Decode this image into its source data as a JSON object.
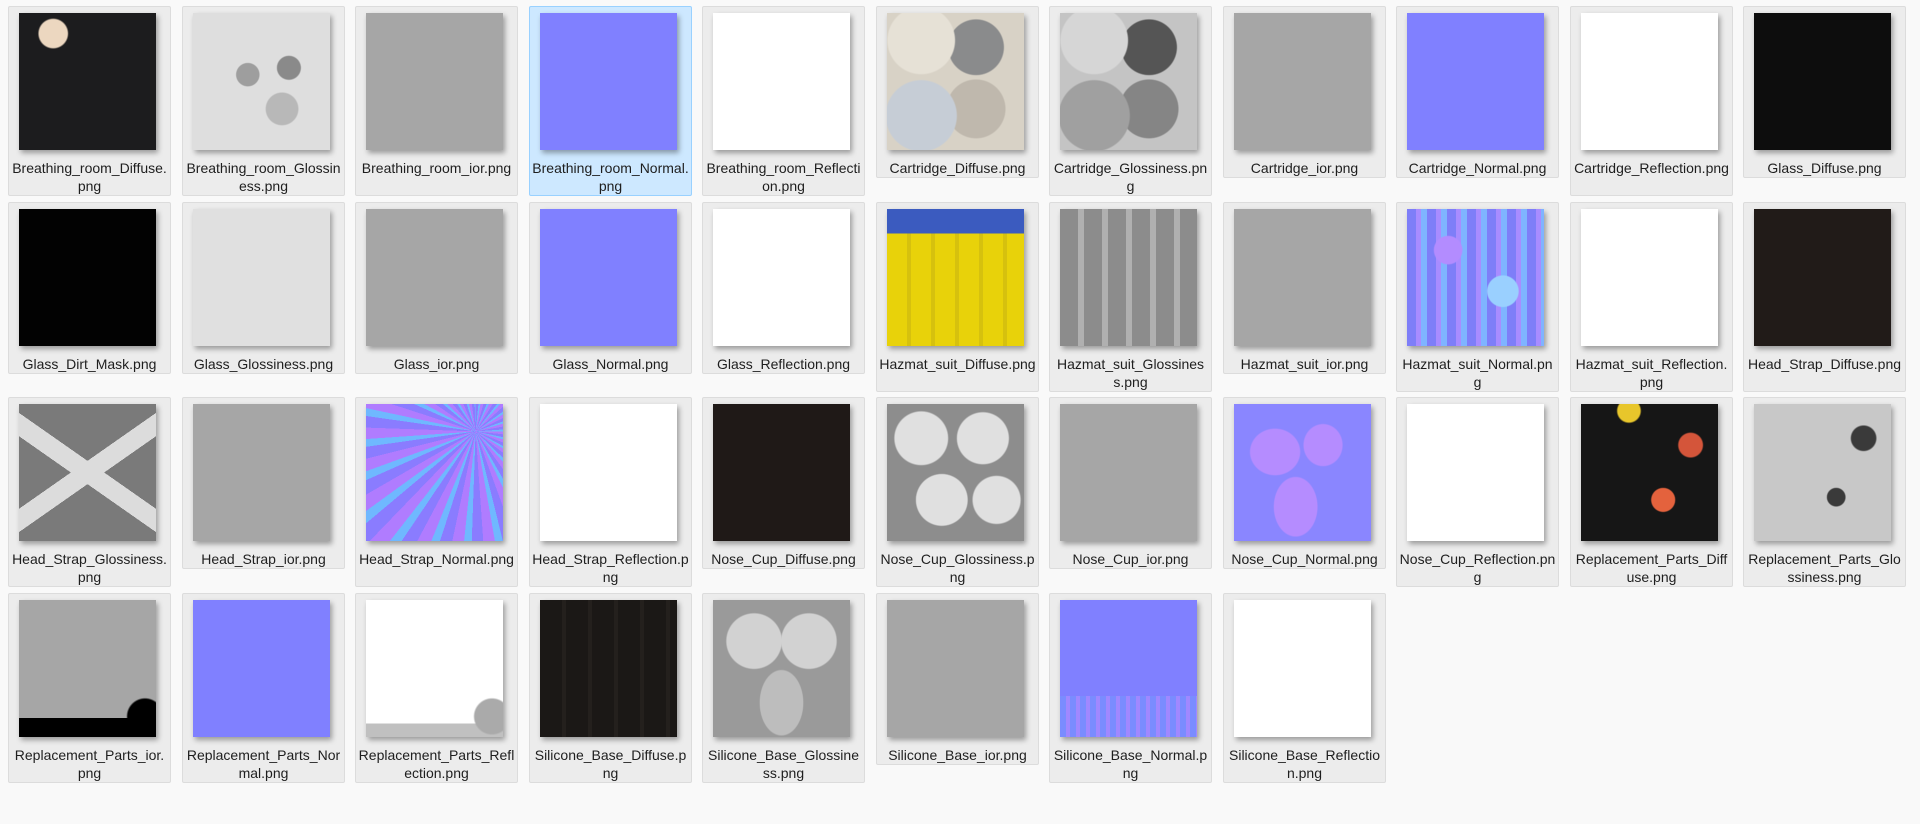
{
  "window": {
    "title": ""
  },
  "files": [
    {
      "label": "Breathing_room_Diffus\ne.png",
      "texture": "t-breathDiff",
      "selected": false
    },
    {
      "label": "Breathing_room_Glossi\nness.png",
      "texture": "t-glossA",
      "selected": false
    },
    {
      "label": "Breathing_room_ior.pn\ng",
      "texture": "t-grey",
      "selected": false
    },
    {
      "label": "Breathing_room_Norm\nal.png",
      "texture": "t-normal",
      "selected": true
    },
    {
      "label": "Breathing_room_Reflec\ntion.png",
      "texture": "t-white",
      "selected": false
    },
    {
      "label": "Cartridge_Diffuse.png",
      "texture": "t-cartDiff",
      "selected": false
    },
    {
      "label": "Cartridge_Glossiness.p\nng",
      "texture": "t-cartGloss",
      "selected": false
    },
    {
      "label": "Cartridge_ior.png",
      "texture": "t-grey",
      "selected": false
    },
    {
      "label": "Cartridge_Normal.png",
      "texture": "t-normal",
      "selected": false
    },
    {
      "label": "Cartridge_Reflection.pn\ng",
      "texture": "t-white",
      "selected": false
    },
    {
      "label": "Glass_Diffuse.png",
      "texture": "t-black2",
      "selected": false
    },
    {
      "label": "Glass_Dirt_Mask.png",
      "texture": "t-black",
      "selected": false
    },
    {
      "label": "Glass_Glossiness.png",
      "texture": "t-lgrey",
      "selected": false
    },
    {
      "label": "Glass_ior.png",
      "texture": "t-grey",
      "selected": false
    },
    {
      "label": "Glass_Normal.png",
      "texture": "t-normal",
      "selected": false
    },
    {
      "label": "Glass_Reflection.png",
      "texture": "t-white",
      "selected": false
    },
    {
      "label": "Hazmat_suit_Diffuse.pn\ng",
      "texture": "t-hazDiff",
      "selected": false
    },
    {
      "label": "Hazmat_suit_Glossiness\n.png",
      "texture": "t-hazGloss",
      "selected": false
    },
    {
      "label": "Hazmat_suit_ior.png",
      "texture": "t-grey",
      "selected": false
    },
    {
      "label": "Hazmat_suit_Normal.p\nng",
      "texture": "t-normal2",
      "selected": false
    },
    {
      "label": "Hazmat_suit_Reflection\n.png",
      "texture": "t-white",
      "selected": false
    },
    {
      "label": "Head_Strap_Diffuse.pn\ng",
      "texture": "t-brown",
      "selected": false
    },
    {
      "label": "Head_Strap_Glossiness.\npng",
      "texture": "t-strapGloss",
      "selected": false
    },
    {
      "label": "Head_Strap_ior.png",
      "texture": "t-grey",
      "selected": false
    },
    {
      "label": "Head_Strap_Normal.pn\ng",
      "texture": "t-normal3",
      "selected": false
    },
    {
      "label": "Head_Strap_Reflection.\npng",
      "texture": "t-white",
      "selected": false
    },
    {
      "label": "Nose_Cup_Diffuse.png",
      "texture": "t-brown2",
      "selected": false
    },
    {
      "label": "Nose_Cup_Glossiness.p\nng",
      "texture": "t-noseGloss",
      "selected": false
    },
    {
      "label": "Nose_Cup_ior.png",
      "texture": "t-grey",
      "selected": false
    },
    {
      "label": "Nose_Cup_Normal.png",
      "texture": "t-normal4",
      "selected": false
    },
    {
      "label": "Nose_Cup_Reflection.p\nng",
      "texture": "t-white",
      "selected": false
    },
    {
      "label": "Replacement_Parts_Diff\nuse.png",
      "texture": "t-repDiff",
      "selected": false
    },
    {
      "label": "Replacement_Parts_Glo\nssiness.png",
      "texture": "t-repGloss",
      "selected": false
    },
    {
      "label": "Replacement_Parts_ior.\npng",
      "texture": "t-repIor",
      "selected": false
    },
    {
      "label": "Replacement_Parts_No\nrmal.png",
      "texture": "t-repNorm",
      "selected": false
    },
    {
      "label": "Replacement_Parts_Ref\nlection.png",
      "texture": "t-repRefl",
      "selected": false
    },
    {
      "label": "Silicone_Base_Diffuse.p\nng",
      "texture": "t-siliDiff",
      "selected": false
    },
    {
      "label": "Silicone_Base_Glossines\ns.png",
      "texture": "t-siliGloss",
      "selected": false
    },
    {
      "label": "Silicone_Base_ior.png",
      "texture": "t-grey",
      "selected": false
    },
    {
      "label": "Silicone_Base_Normal.\npng",
      "texture": "t-normal5",
      "selected": false
    },
    {
      "label": "Silicone_Base_Reflectio\nn.png",
      "texture": "t-white",
      "selected": false
    }
  ]
}
